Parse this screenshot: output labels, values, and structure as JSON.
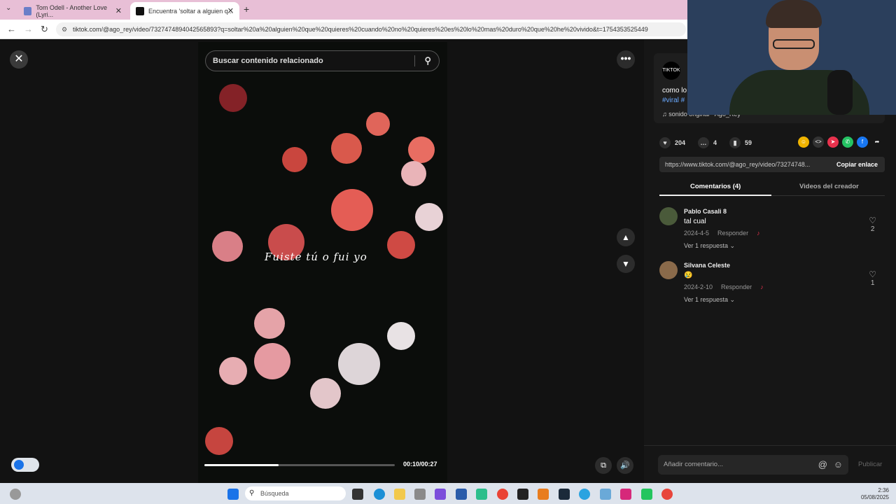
{
  "browser": {
    "tabs": [
      {
        "title": "Tom Odell - Another Love (Lyri..."
      },
      {
        "title": "Encuentra 'soltar a alguien q..."
      }
    ],
    "url": "tiktok.com/@ago_rey/video/7327474894042565893?q=soltar%20a%20alguien%20que%20quieres%20cuando%20no%20quieres%20es%20lo%20mas%20duro%20que%20he%20vivido&t=1754353525449"
  },
  "video": {
    "search_placeholder": "Buscar contenido relacionado",
    "lyric": "Fuiste tú o fui yo",
    "time": "00:10/00:27",
    "progress": 0.39
  },
  "post": {
    "avatar_text": "TIKTOK",
    "description": "como lo",
    "tags": "#viral #",
    "sound": "sonido original - Ago_Rey",
    "likes": "204",
    "comments": "4",
    "saves": "59",
    "link": "https://www.tiktok.com/@ago_rey/video/73274748...",
    "copy_label": "Copiar enlace"
  },
  "tabs": {
    "comments_label": "Comentarios (4)",
    "creator_label": "Videos del creador"
  },
  "comments": [
    {
      "name": "Pablo Casali 8",
      "text": "tal cual",
      "date": "2024-4-5",
      "reply": "Responder",
      "replies": "Ver 1 respuesta",
      "likes": "2",
      "avatar_color": "#4a5a3a"
    },
    {
      "name": "Silvana Celeste",
      "text": "😢",
      "date": "2024-2-10",
      "reply": "Responder",
      "replies": "Ver 1 respuesta",
      "likes": "1",
      "avatar_color": "#8a6a4a"
    }
  ],
  "composer": {
    "placeholder": "Añadir comentario...",
    "publish": "Publicar"
  },
  "taskbar": {
    "search": "Búsqueda",
    "time": "2:36",
    "date": "05/08/2025"
  }
}
